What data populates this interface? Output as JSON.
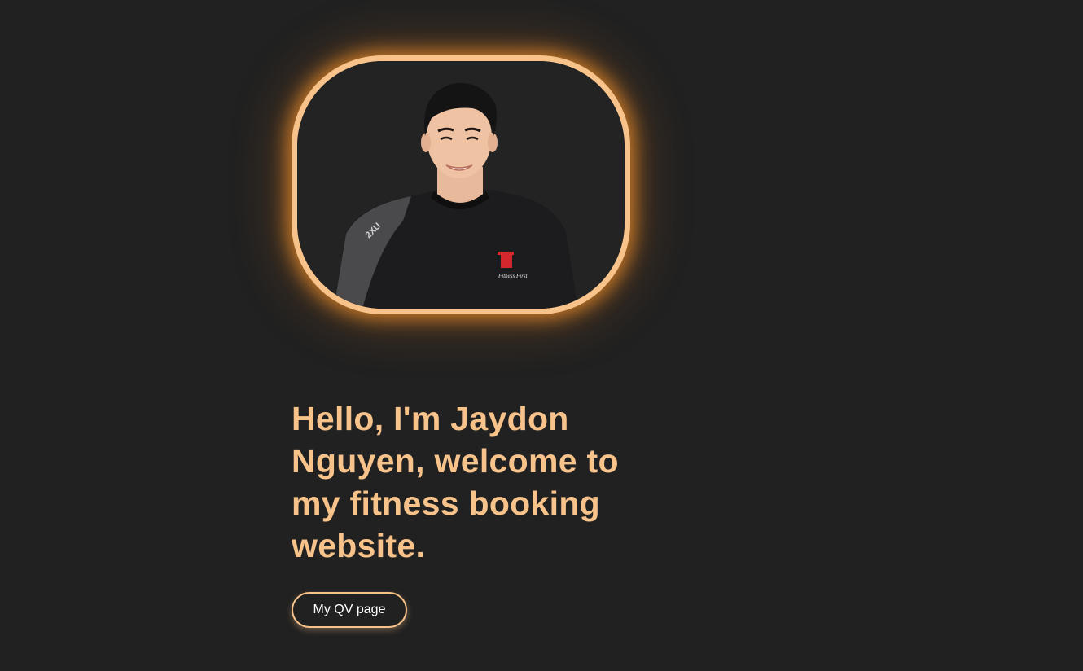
{
  "profile": {
    "photo_description": "portrait-photo",
    "shirt_brand_mark": "2XU",
    "shirt_logo_text": "Fitness First"
  },
  "hero": {
    "headline": "Hello, I'm Jaydon Nguyen, welcome to my fitness booking website."
  },
  "actions": {
    "qv_button_label": "My QV page"
  },
  "colors": {
    "background": "#212121",
    "accent": "#f7c38a",
    "glow": "#ec8d2a",
    "button_text": "#ffffff"
  }
}
